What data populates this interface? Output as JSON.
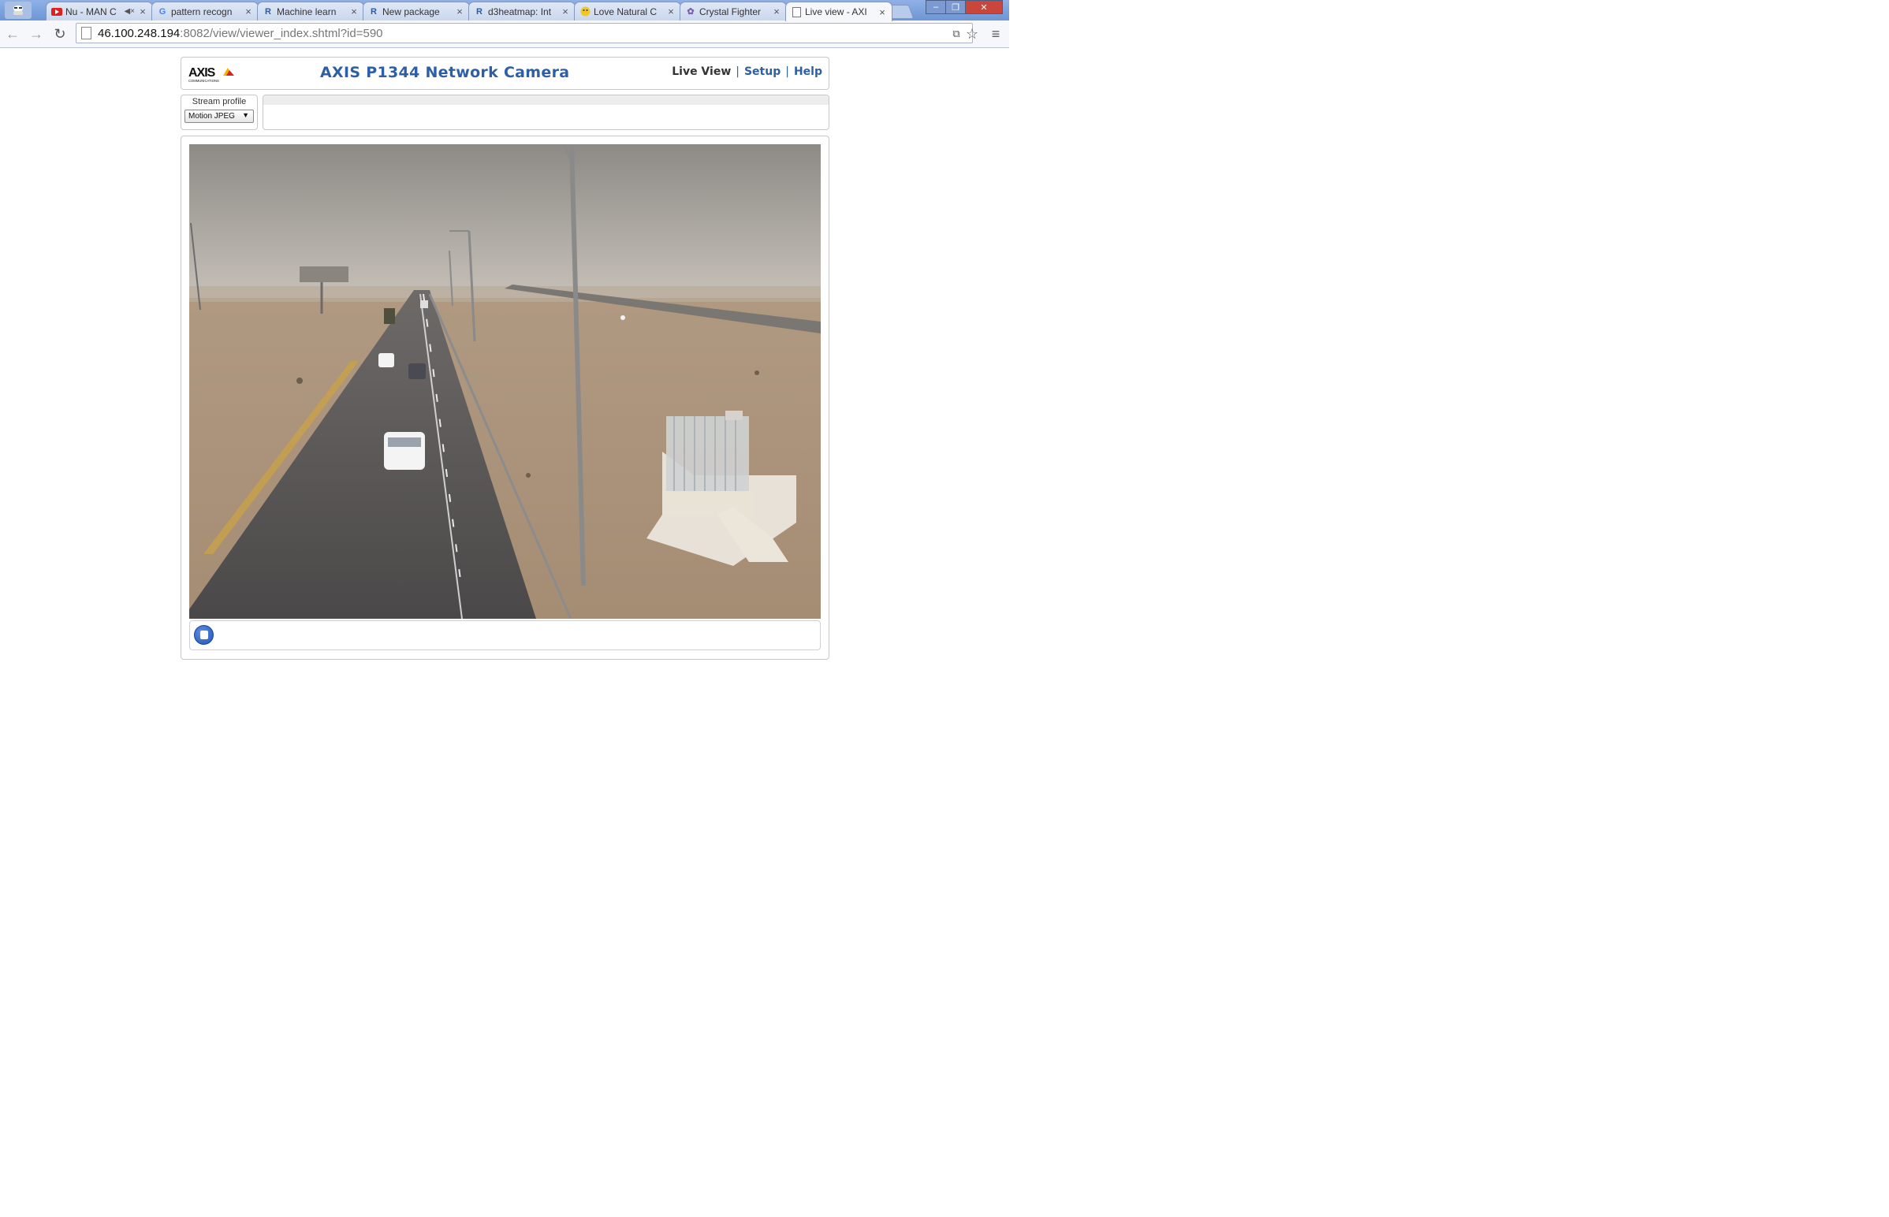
{
  "browser": {
    "tabs": [
      {
        "title": "Nu - MAN C",
        "favicon": "youtube-icon",
        "muted": true
      },
      {
        "title": "pattern recogn",
        "favicon": "google-icon"
      },
      {
        "title": "Machine learn",
        "favicon": "r-icon"
      },
      {
        "title": "New package",
        "favicon": "r-icon"
      },
      {
        "title": "d3heatmap: Int",
        "favicon": "r-icon"
      },
      {
        "title": "Love Natural C",
        "favicon": "smiley-icon"
      },
      {
        "title": "Crystal Fighter",
        "favicon": "flower-icon"
      },
      {
        "title": "Live view - AXI",
        "favicon": "page-icon",
        "active": true
      }
    ],
    "url_host": "46.100.248.194",
    "url_path": ":8082/view/viewer_index.shtml?id=590"
  },
  "page": {
    "logo_text": "AXIS",
    "logo_subtext": "COMMUNICATIONS",
    "camera_title": "AXIS P1344 Network Camera",
    "nav": {
      "live_view": "Live View",
      "setup": "Setup",
      "help": "Help",
      "separator": "|"
    },
    "stream_profile": {
      "label": "Stream profile",
      "selected": "Motion JPEG"
    }
  },
  "colors": {
    "title_blue": "#2d5fa6",
    "stop_button": "#2a63c8"
  }
}
